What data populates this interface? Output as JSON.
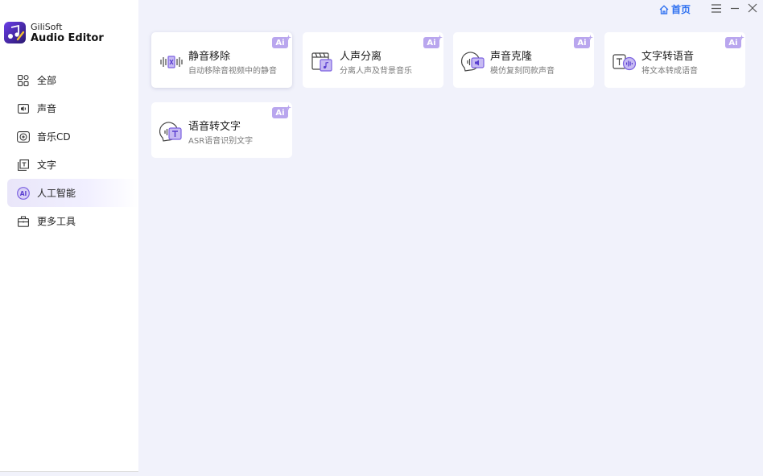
{
  "app": {
    "brand": "GiliSoft",
    "product": "Audio Editor"
  },
  "titlebar": {
    "home_label": "首页"
  },
  "sidebar": {
    "items": [
      {
        "label": "全部",
        "icon": "grid-icon"
      },
      {
        "label": "声音",
        "icon": "sound-icon"
      },
      {
        "label": "音乐CD",
        "icon": "music-cd-icon"
      },
      {
        "label": "文字",
        "icon": "text-icon"
      },
      {
        "label": "人工智能",
        "icon": "ai-icon",
        "active": true
      },
      {
        "label": "更多工具",
        "icon": "toolbox-icon"
      }
    ]
  },
  "cards": [
    {
      "title": "静音移除",
      "desc": "自动移除音视频中的静音",
      "badge": "Ai",
      "icon": "silence-removal-icon"
    },
    {
      "title": "人声分离",
      "desc": "分离人声及背景音乐",
      "badge": "Ai",
      "icon": "vocal-separation-icon"
    },
    {
      "title": "声音克隆",
      "desc": "模仿复刻同款声音",
      "badge": "Ai",
      "icon": "voice-clone-icon"
    },
    {
      "title": "文字转语音",
      "desc": "将文本转成语音",
      "badge": "Ai",
      "icon": "text-to-speech-icon"
    },
    {
      "title": "语音转文字",
      "desc": "ASR语音识别文字",
      "badge": "Ai",
      "icon": "speech-to-text-icon"
    }
  ],
  "colors": {
    "accent": "#2c6ff0",
    "ai_badge": "#b9a6ee",
    "icon_purple": "#7b61e0",
    "background": "#f1f2fb"
  }
}
